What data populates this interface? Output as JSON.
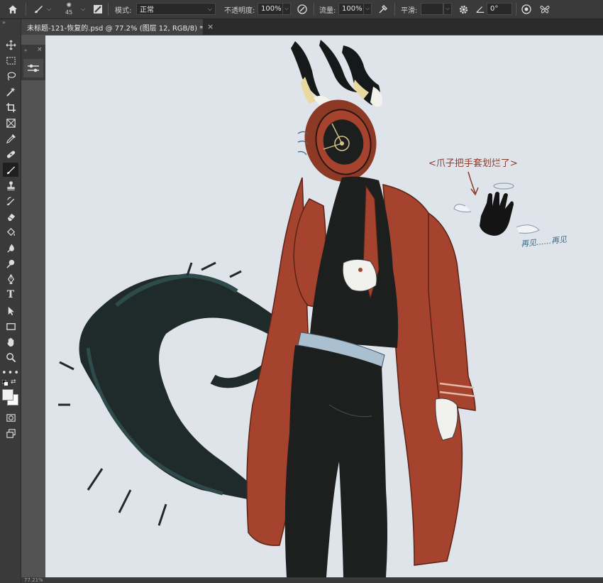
{
  "options_bar": {
    "brush_size": "45",
    "mode_label": "模式:",
    "mode_value": "正常",
    "opacity_label": "不透明度:",
    "opacity_value": "100%",
    "flow_label": "流量:",
    "flow_value": "100%",
    "smoothing_label": "平滑:",
    "smoothing_value": "",
    "angle_value": "0°"
  },
  "document": {
    "tab_title": "未标题-121-恢复的.psd @ 77.2% (图层 12, RGB/8) *",
    "close_glyph": "×"
  },
  "canvas": {
    "caption": "<爪子把手套划烂了>",
    "goodbye": "再见......再见"
  },
  "status_bar": {
    "zoom": "77.21%"
  },
  "toolbar": {
    "active_tool": "brush-tool",
    "tools": [
      "move",
      "marquee",
      "lasso",
      "magic-wand",
      "crop",
      "frame",
      "eyedropper",
      "healing",
      "brush",
      "stamp",
      "history-brush",
      "eraser",
      "paint-bucket",
      "blur",
      "dodge",
      "pen",
      "type",
      "path-select",
      "rectangle",
      "hand",
      "zoom",
      "more"
    ]
  },
  "colors": {
    "canvas_bg": "#dfe4ea",
    "coat": "#a6432f",
    "shirt": "#1c1f1d",
    "tail": "#1f2b2b",
    "flame_yellow": "#e9d9a0",
    "caption": "#8a3a2f",
    "doodle": "#3e6a86"
  }
}
